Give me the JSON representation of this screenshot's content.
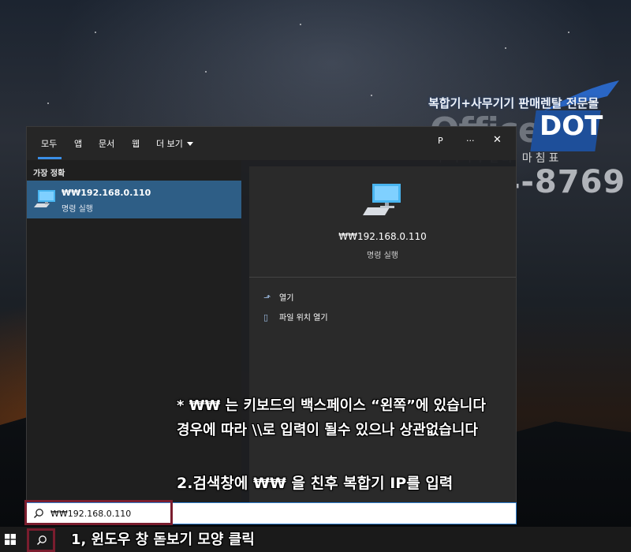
{
  "logo": {
    "tagline": "복합기+사무기기 판매렌탈 전문몰",
    "word": "Office",
    "badge": "DOT",
    "sub": "우리사무실의 마침표",
    "phone": "1544-8769"
  },
  "search_panel": {
    "tabs": [
      {
        "label": "모두",
        "active": true
      },
      {
        "label": "앱"
      },
      {
        "label": "문서"
      },
      {
        "label": "웹"
      },
      {
        "label": "더 보기"
      }
    ],
    "header_icons": {
      "profile": "P",
      "more": "···",
      "close": "✕"
    },
    "best_match_header": "가장 정확",
    "result": {
      "title": "₩₩192.168.0.110",
      "subtitle": "명령 실행"
    },
    "preview": {
      "title": "₩₩192.168.0.110",
      "subtitle": "명령 실행",
      "actions": [
        {
          "label": "열기",
          "icon": "open-icon"
        },
        {
          "label": "파일 위치 열기",
          "icon": "file-location-icon"
        }
      ]
    }
  },
  "annotations": {
    "note_line1": "* ₩₩ 는 키보드의 백스페이스 “왼쪽”에 있습니다",
    "note_line2": "경우에 따라 \\\\로 입력이 될수 있으나 상관없습니다",
    "step2": "2.검색창에 ₩₩ 을 친후 복합기 IP를 입력",
    "step1": "1, 윈도우 창 돋보기 모양 클릭"
  },
  "search_box": {
    "value": "₩₩192.168.0.110"
  },
  "colors": {
    "accent": "#3a8ee6",
    "result_highlight": "#2e5e86",
    "highlight_frame": "#7a1d2e"
  }
}
